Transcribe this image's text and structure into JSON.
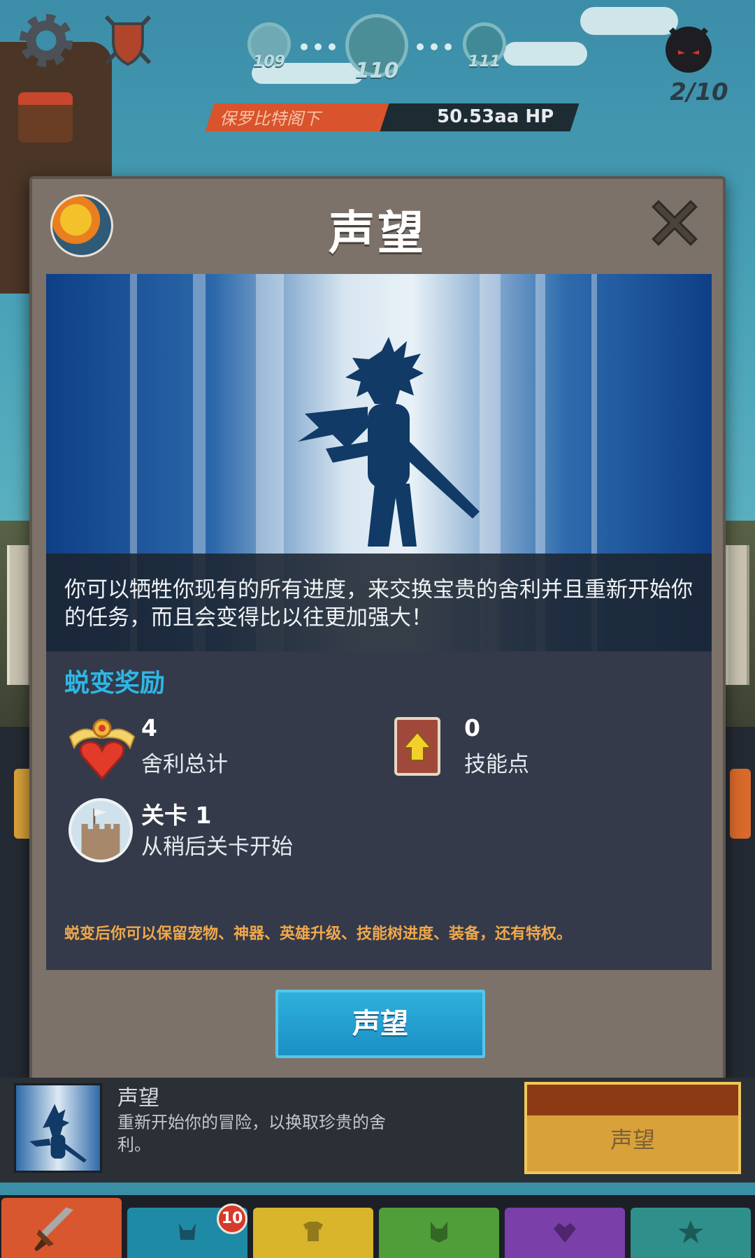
{
  "hud": {
    "stages": [
      {
        "label": "109"
      },
      {
        "label": "110"
      },
      {
        "label": "111"
      }
    ],
    "wave_count": "2/10",
    "boss_name": "保罗比特阁下",
    "boss_hp": "50.53aa HP"
  },
  "modal": {
    "title": "声望",
    "description": "你可以牺牲你现有的所有进度，来交换宝贵的舍利并且重新开始你的任务，而且会变得比以往更加强大！",
    "rewards_title": "蜕变奖励",
    "rewards": {
      "relics_value": "4",
      "relics_label": "舍利总计",
      "skill_value": "0",
      "skill_label": "技能点",
      "stage_value": "关卡 1",
      "stage_label": "从稍后关卡开始"
    },
    "footnote": "蜕变后你可以保留宠物、神器、英雄升级、技能树进度、装备，还有特权。",
    "button_label": "声望"
  },
  "row": {
    "title": "声望",
    "description": "重新开始你的冒险，以换取珍贵的舍利。",
    "button_label": "声望"
  },
  "tabs": {
    "items": [
      {
        "name": "sword",
        "color": "#d9572e"
      },
      {
        "name": "heroes",
        "color": "#1f8aa5"
      },
      {
        "name": "equipment",
        "color": "#d8b52a"
      },
      {
        "name": "pets",
        "color": "#4f9e3a"
      },
      {
        "name": "artifacts",
        "color": "#7a3fa8"
      },
      {
        "name": "shop",
        "color": "#2f8f8a"
      }
    ],
    "badge": "10"
  },
  "colors": {
    "accent_blue": "#2fb6e3",
    "footnote_orange": "#f0a84a",
    "modal_bg": "#7c7269",
    "panel_dark": "#343a4a"
  }
}
